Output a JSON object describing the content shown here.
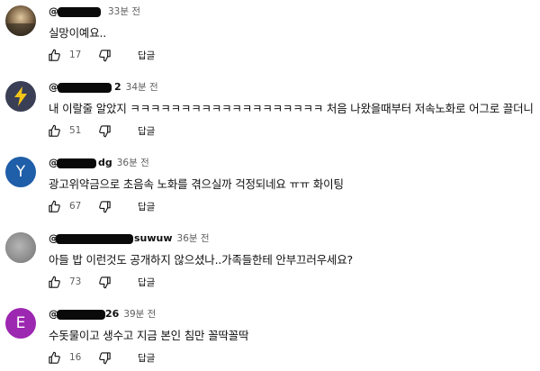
{
  "comments": [
    {
      "handle": "@",
      "time": "33분 전",
      "text": "실망이예요..",
      "likes": "17",
      "reply_label": "답글"
    },
    {
      "handle": "@",
      "handle_suffix": "2",
      "time": "34분 전",
      "text": "내 이랄줄 알았지 ㅋㅋㅋㅋㅋㅋㅋㅋㅋㅋㅋㅋㅋㅋㅋㅋㅋㅋㅋ 처음 나왔을때부터 저속노화로 어그로 끌더니",
      "likes": "51",
      "reply_label": "답글"
    },
    {
      "handle": "@",
      "handle_suffix": "dg",
      "time": "36분 전",
      "text": "광고위약금으로 초음속 노화를 겪으실까 걱정되네요 ㅠㅠ 화이팅",
      "likes": "67",
      "reply_label": "답글",
      "avatar_letter": "Y"
    },
    {
      "handle": "@",
      "handle_suffix": "suwuw",
      "time": "36분 전",
      "text": "아들 밥 이런것도 공개하지 않으셨나..가족들한테 안부끄러우세요?",
      "likes": "73",
      "reply_label": "답글"
    },
    {
      "handle": "@",
      "handle_suffix": "26",
      "time": "39분 전",
      "text": "수돗물이고 생수고 지금 본인 침만 꼴딱꼴딱",
      "likes": "16",
      "reply_label": "답글",
      "avatar_letter": "E"
    }
  ],
  "colors": {
    "avatar_lightning_bg": "#3a3f55",
    "avatar_lightning": "#f5c518",
    "avatar_y": "#1f5ea8",
    "avatar_gray": "#9a9a9a",
    "avatar_e": "#9c27b0",
    "redaction": "#0a0a0a",
    "secondary_text": "#606060"
  },
  "icons": [
    "like-icon",
    "dislike-icon",
    "lightning-icon"
  ]
}
